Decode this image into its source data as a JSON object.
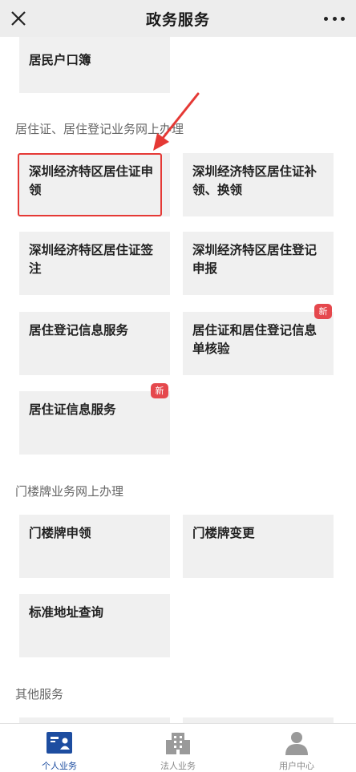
{
  "header": {
    "title": "政务服务",
    "close_icon": "close-icon",
    "more_icon": "more-icon"
  },
  "top_partial_card": {
    "label": "居民户口簿"
  },
  "sections": [
    {
      "title": "居住证、居住登记业务网上办理",
      "items": [
        {
          "label": "深圳经济特区居住证申领",
          "highlighted": true
        },
        {
          "label": "深圳经济特区居住证补领、换领"
        },
        {
          "label": "深圳经济特区居住证签注"
        },
        {
          "label": "深圳经济特区居住登记申报"
        },
        {
          "label": "居住登记信息服务"
        },
        {
          "label": "居住证和居住登记信息单核验",
          "badge": "新"
        },
        {
          "label": "居住证信息服务",
          "badge": "新"
        }
      ]
    },
    {
      "title": "门楼牌业务网上办理",
      "items": [
        {
          "label": "门楼牌申领"
        },
        {
          "label": "门楼牌变更"
        },
        {
          "label": "标准地址查询"
        }
      ]
    },
    {
      "title": "其他服务",
      "items": []
    }
  ],
  "tabs": [
    {
      "label": "个人业务",
      "icon": "personal-id-icon",
      "active": true
    },
    {
      "label": "法人业务",
      "icon": "building-icon",
      "active": false
    },
    {
      "label": "用户中心",
      "icon": "user-icon",
      "active": false
    }
  ],
  "colors": {
    "accent": "#1d4da0",
    "highlight": "#e53935",
    "badge": "#e5484d",
    "card_bg": "#f0f0f0"
  }
}
